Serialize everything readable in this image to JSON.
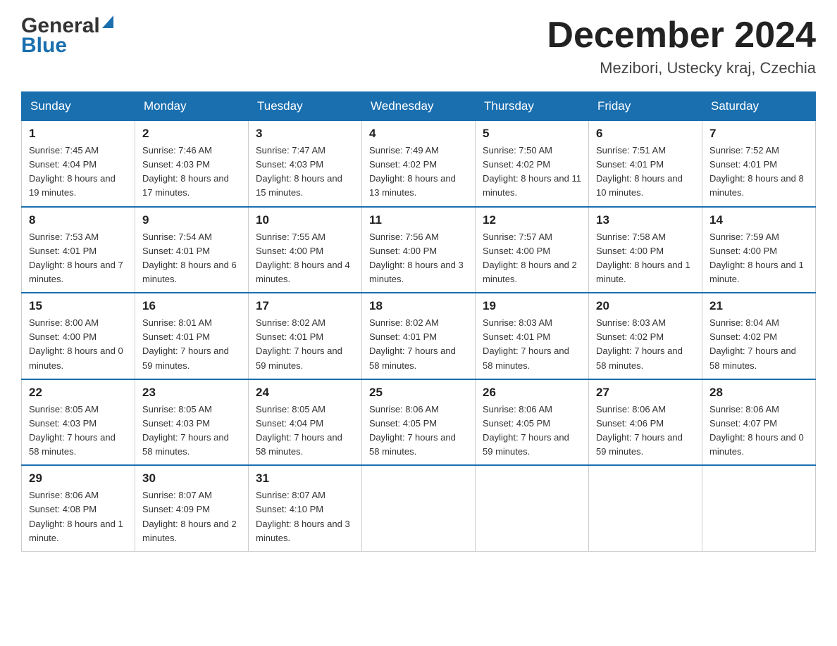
{
  "header": {
    "title": "December 2024",
    "subtitle": "Mezibori, Ustecky kraj, Czechia",
    "logo_general": "General",
    "logo_blue": "Blue"
  },
  "days_of_week": [
    "Sunday",
    "Monday",
    "Tuesday",
    "Wednesday",
    "Thursday",
    "Friday",
    "Saturday"
  ],
  "weeks": [
    [
      {
        "date": "1",
        "sunrise": "7:45 AM",
        "sunset": "4:04 PM",
        "daylight": "8 hours and 19 minutes."
      },
      {
        "date": "2",
        "sunrise": "7:46 AM",
        "sunset": "4:03 PM",
        "daylight": "8 hours and 17 minutes."
      },
      {
        "date": "3",
        "sunrise": "7:47 AM",
        "sunset": "4:03 PM",
        "daylight": "8 hours and 15 minutes."
      },
      {
        "date": "4",
        "sunrise": "7:49 AM",
        "sunset": "4:02 PM",
        "daylight": "8 hours and 13 minutes."
      },
      {
        "date": "5",
        "sunrise": "7:50 AM",
        "sunset": "4:02 PM",
        "daylight": "8 hours and 11 minutes."
      },
      {
        "date": "6",
        "sunrise": "7:51 AM",
        "sunset": "4:01 PM",
        "daylight": "8 hours and 10 minutes."
      },
      {
        "date": "7",
        "sunrise": "7:52 AM",
        "sunset": "4:01 PM",
        "daylight": "8 hours and 8 minutes."
      }
    ],
    [
      {
        "date": "8",
        "sunrise": "7:53 AM",
        "sunset": "4:01 PM",
        "daylight": "8 hours and 7 minutes."
      },
      {
        "date": "9",
        "sunrise": "7:54 AM",
        "sunset": "4:01 PM",
        "daylight": "8 hours and 6 minutes."
      },
      {
        "date": "10",
        "sunrise": "7:55 AM",
        "sunset": "4:00 PM",
        "daylight": "8 hours and 4 minutes."
      },
      {
        "date": "11",
        "sunrise": "7:56 AM",
        "sunset": "4:00 PM",
        "daylight": "8 hours and 3 minutes."
      },
      {
        "date": "12",
        "sunrise": "7:57 AM",
        "sunset": "4:00 PM",
        "daylight": "8 hours and 2 minutes."
      },
      {
        "date": "13",
        "sunrise": "7:58 AM",
        "sunset": "4:00 PM",
        "daylight": "8 hours and 1 minute."
      },
      {
        "date": "14",
        "sunrise": "7:59 AM",
        "sunset": "4:00 PM",
        "daylight": "8 hours and 1 minute."
      }
    ],
    [
      {
        "date": "15",
        "sunrise": "8:00 AM",
        "sunset": "4:00 PM",
        "daylight": "8 hours and 0 minutes."
      },
      {
        "date": "16",
        "sunrise": "8:01 AM",
        "sunset": "4:01 PM",
        "daylight": "7 hours and 59 minutes."
      },
      {
        "date": "17",
        "sunrise": "8:02 AM",
        "sunset": "4:01 PM",
        "daylight": "7 hours and 59 minutes."
      },
      {
        "date": "18",
        "sunrise": "8:02 AM",
        "sunset": "4:01 PM",
        "daylight": "7 hours and 58 minutes."
      },
      {
        "date": "19",
        "sunrise": "8:03 AM",
        "sunset": "4:01 PM",
        "daylight": "7 hours and 58 minutes."
      },
      {
        "date": "20",
        "sunrise": "8:03 AM",
        "sunset": "4:02 PM",
        "daylight": "7 hours and 58 minutes."
      },
      {
        "date": "21",
        "sunrise": "8:04 AM",
        "sunset": "4:02 PM",
        "daylight": "7 hours and 58 minutes."
      }
    ],
    [
      {
        "date": "22",
        "sunrise": "8:05 AM",
        "sunset": "4:03 PM",
        "daylight": "7 hours and 58 minutes."
      },
      {
        "date": "23",
        "sunrise": "8:05 AM",
        "sunset": "4:03 PM",
        "daylight": "7 hours and 58 minutes."
      },
      {
        "date": "24",
        "sunrise": "8:05 AM",
        "sunset": "4:04 PM",
        "daylight": "7 hours and 58 minutes."
      },
      {
        "date": "25",
        "sunrise": "8:06 AM",
        "sunset": "4:05 PM",
        "daylight": "7 hours and 58 minutes."
      },
      {
        "date": "26",
        "sunrise": "8:06 AM",
        "sunset": "4:05 PM",
        "daylight": "7 hours and 59 minutes."
      },
      {
        "date": "27",
        "sunrise": "8:06 AM",
        "sunset": "4:06 PM",
        "daylight": "7 hours and 59 minutes."
      },
      {
        "date": "28",
        "sunrise": "8:06 AM",
        "sunset": "4:07 PM",
        "daylight": "8 hours and 0 minutes."
      }
    ],
    [
      {
        "date": "29",
        "sunrise": "8:06 AM",
        "sunset": "4:08 PM",
        "daylight": "8 hours and 1 minute."
      },
      {
        "date": "30",
        "sunrise": "8:07 AM",
        "sunset": "4:09 PM",
        "daylight": "8 hours and 2 minutes."
      },
      {
        "date": "31",
        "sunrise": "8:07 AM",
        "sunset": "4:10 PM",
        "daylight": "8 hours and 3 minutes."
      },
      null,
      null,
      null,
      null
    ]
  ]
}
